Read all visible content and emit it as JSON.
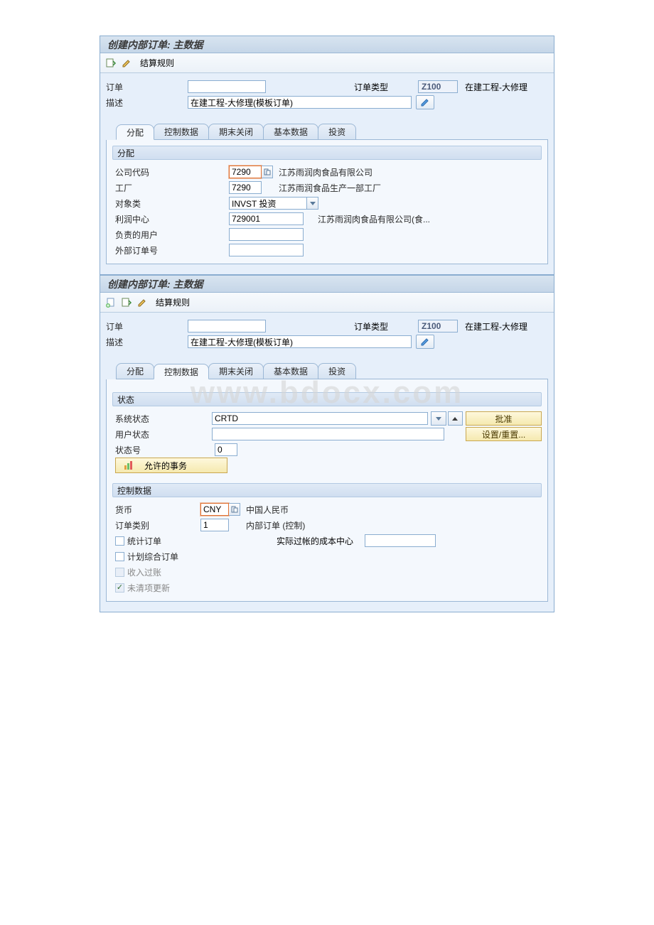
{
  "watermark": "www.bdocx.com",
  "panel1": {
    "title": "创建内部订单: 主数据",
    "toolbar": {
      "settle_rule": "结算规则"
    },
    "header": {
      "order_label": "订单",
      "order_value": "",
      "order_type_label": "订单类型",
      "order_type_value": "Z100",
      "order_type_text": "在建工程-大修理",
      "desc_label": "描述",
      "desc_value": "在建工程-大修理(模板订单)"
    },
    "tabs": [
      "分配",
      "控制数据",
      "期末关闭",
      "基本数据",
      "投资"
    ],
    "active_tab": 0,
    "group": {
      "title": "分配",
      "rows": {
        "company_code_label": "公司代码",
        "company_code_value": "7290",
        "company_code_text": "江苏雨润肉食品有限公司",
        "plant_label": "工厂",
        "plant_value": "7290",
        "plant_text": "江苏雨润食品生产一部工厂",
        "object_class_label": "对象类",
        "object_class_value": "INVST 投资",
        "profit_center_label": "利润中心",
        "profit_center_value": "729001",
        "profit_center_text": "江苏雨润肉食品有限公司(食...",
        "responsible_label": "负责的用户",
        "responsible_value": "",
        "external_order_label": "外部订单号",
        "external_order_value": ""
      }
    }
  },
  "panel2": {
    "title": "创建内部订单: 主数据",
    "toolbar": {
      "settle_rule": "结算规则"
    },
    "header": {
      "order_label": "订单",
      "order_value": "",
      "order_type_label": "订单类型",
      "order_type_value": "Z100",
      "order_type_text": "在建工程-大修理",
      "desc_label": "描述",
      "desc_value": "在建工程-大修理(模板订单)"
    },
    "tabs": [
      "分配",
      "控制数据",
      "期末关闭",
      "基本数据",
      "投资"
    ],
    "active_tab": 1,
    "group_status": {
      "title": "状态",
      "system_status_label": "系统状态",
      "system_status_value": "CRTD",
      "approve_label": "批准",
      "user_status_label": "用户状态",
      "user_status_value": "",
      "set_reset_label": "设置/重置...",
      "status_num_label": "状态号",
      "status_num_value": "0",
      "allowed_trans_label": "允许的事务"
    },
    "group_control": {
      "title": "控制数据",
      "currency_label": "货币",
      "currency_value": "CNY",
      "currency_text": "中国人民币",
      "order_category_label": "订单类别",
      "order_category_value": "1",
      "order_category_text": "内部订单 (控制)",
      "statistical_label": "统计订单",
      "actual_cc_label": "实际过帐的成本中心",
      "actual_cc_value": "",
      "plan_integrated_label": "计划综合订单",
      "revenue_posting_label": "收入过账",
      "open_item_label": "未清项更新"
    }
  }
}
